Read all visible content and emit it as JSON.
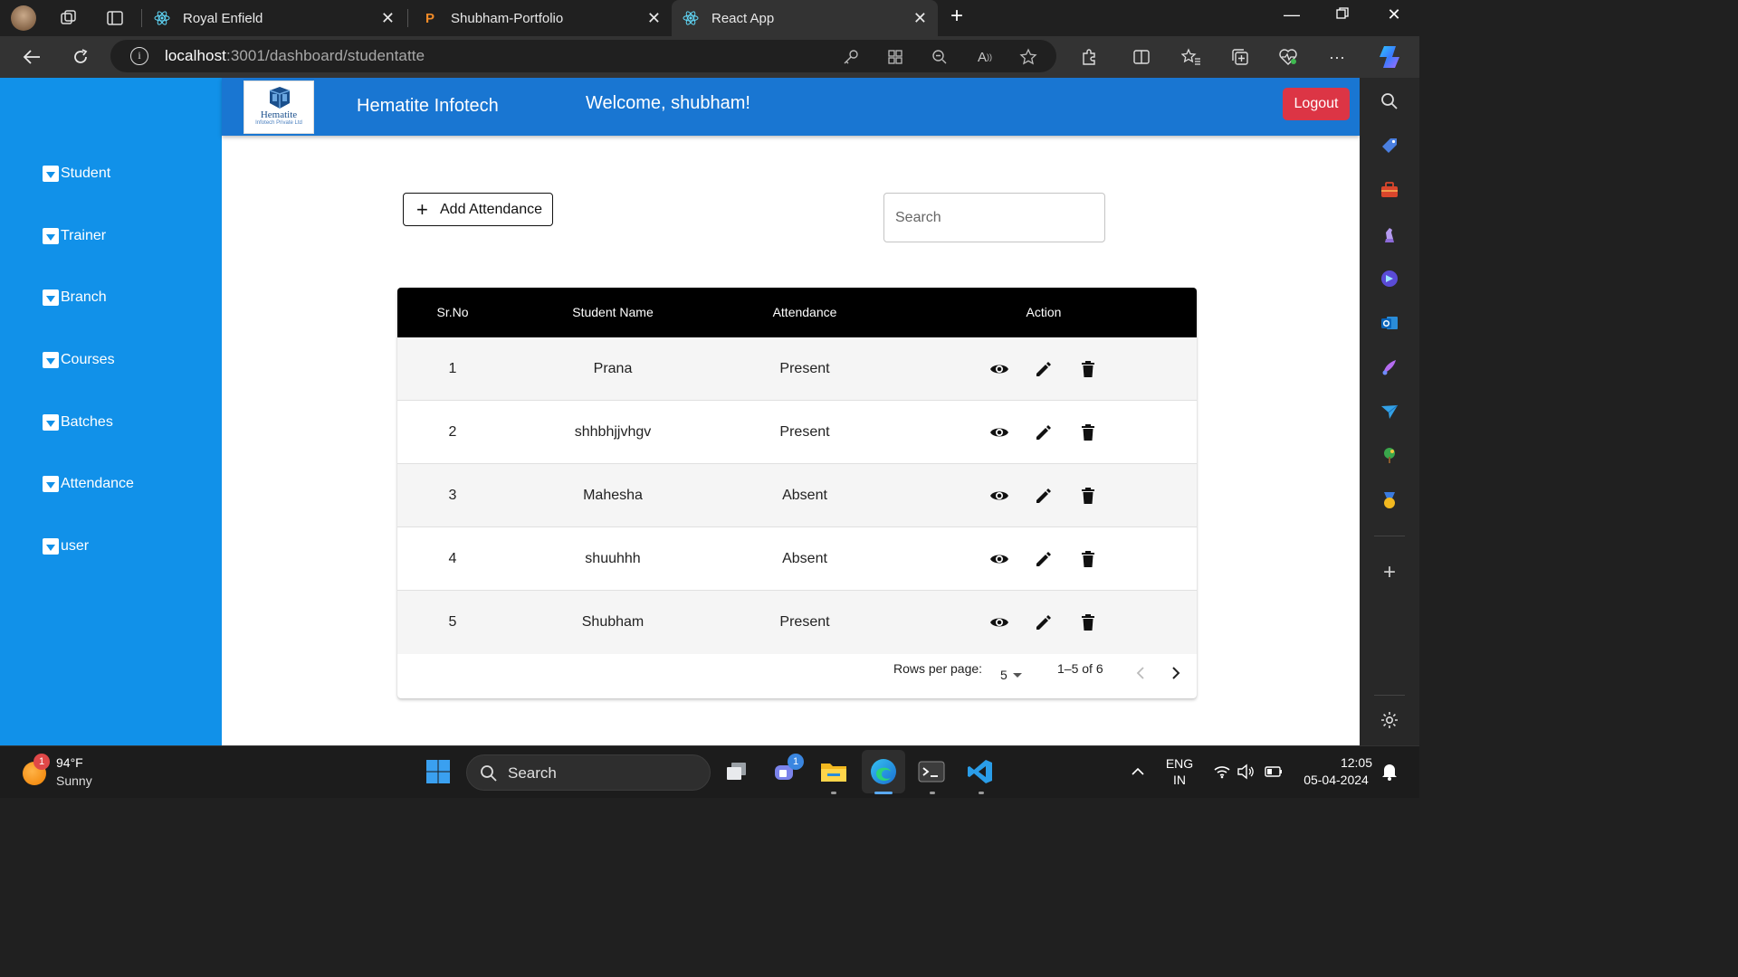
{
  "browser": {
    "tabs": [
      {
        "title": "Royal Enfield",
        "active": false
      },
      {
        "title": "Shubham-Portfolio",
        "active": false
      },
      {
        "title": "React App",
        "active": true
      }
    ],
    "url_host": "localhost",
    "url_path": ":3001/dashboard/studentatte"
  },
  "header": {
    "logo_name": "Hematite",
    "logo_sub": "Infotech Private Ltd",
    "brand": "Hematite Infotech",
    "welcome": "Welcome, shubham!",
    "logout_label": "Logout"
  },
  "sidebar": {
    "items": [
      {
        "label": "Student"
      },
      {
        "label": "Trainer"
      },
      {
        "label": "Branch"
      },
      {
        "label": "Courses"
      },
      {
        "label": "Batches"
      },
      {
        "label": "Attendance"
      },
      {
        "label": "user"
      }
    ]
  },
  "toolbar": {
    "add_label": "Add Attendance",
    "search_placeholder": "Search"
  },
  "table": {
    "columns": [
      "Sr.No",
      "Student Name",
      "Attendance",
      "Action"
    ],
    "rows": [
      {
        "sr": "1",
        "name": "Prana",
        "attendance": "Present"
      },
      {
        "sr": "2",
        "name": "shhbhjjvhgv",
        "attendance": "Present"
      },
      {
        "sr": "3",
        "name": "Mahesha",
        "attendance": "Absent"
      },
      {
        "sr": "4",
        "name": "shuuhhh",
        "attendance": "Absent"
      },
      {
        "sr": "5",
        "name": "Shubham",
        "attendance": "Present"
      }
    ],
    "pagination": {
      "rows_per_page_label": "Rows per page:",
      "rows_per_page": "5",
      "range": "1–5 of 6"
    }
  },
  "taskbar": {
    "weather_temp": "94°F",
    "weather_cond": "Sunny",
    "weather_badge": "1",
    "search_label": "Search",
    "teams_badge": "1",
    "lang_1": "ENG",
    "lang_2": "IN",
    "time": "12:05",
    "date": "05-04-2024"
  },
  "colors": {
    "sidebar": "#1191e9",
    "header": "#1976d2",
    "logout": "#dc3545"
  }
}
